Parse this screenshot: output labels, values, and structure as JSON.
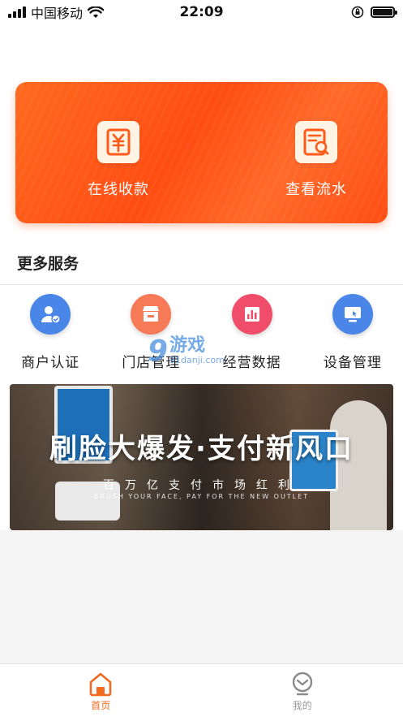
{
  "status_bar": {
    "carrier": "中国移动",
    "time": "22:09"
  },
  "hero": {
    "actions": [
      {
        "label": "在线收款",
        "icon": "yuan-receipt-icon"
      },
      {
        "label": "查看流水",
        "icon": "search-statement-icon"
      }
    ]
  },
  "section": {
    "title": "更多服务"
  },
  "services": [
    {
      "label": "商户认证",
      "icon": "merchant-verify-icon",
      "color": "#4a86e8"
    },
    {
      "label": "门店管理",
      "icon": "store-icon",
      "color": "#f57a55"
    },
    {
      "label": "经营数据",
      "icon": "bar-chart-icon",
      "color": "#f04d6a"
    },
    {
      "label": "设备管理",
      "icon": "device-icon",
      "color": "#4a86e8"
    }
  ],
  "watermark": {
    "number": "9",
    "text": "游戏",
    "url": "91danji.com"
  },
  "banner": {
    "title": "刷脸大爆发·支付新风口",
    "subtitle": "百万亿支付市场红利",
    "english": "BRUSH YOUR FACE, PAY FOR THE NEW OUTLET"
  },
  "tabbar": {
    "items": [
      {
        "label": "首页",
        "active": true,
        "icon": "home-icon"
      },
      {
        "label": "我的",
        "active": false,
        "icon": "profile-icon"
      }
    ]
  },
  "colors": {
    "accent": "#f26b1f",
    "hero_gradient_start": "#ff6a1f",
    "hero_gradient_end": "#ff4e14"
  }
}
